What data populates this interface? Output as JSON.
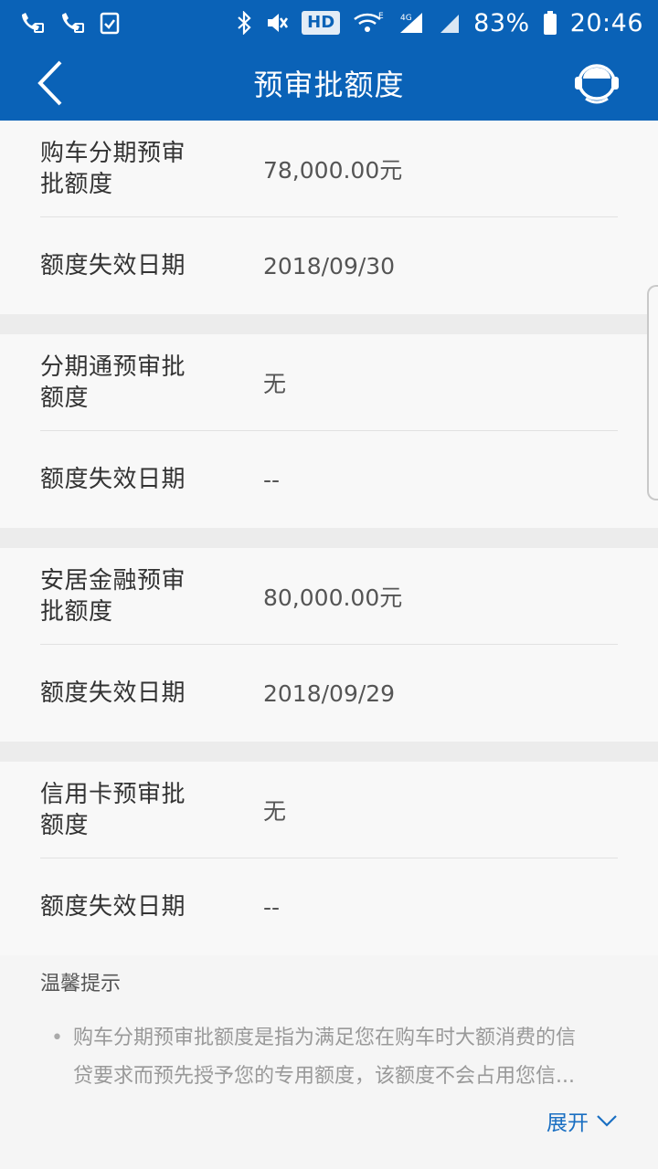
{
  "status_bar": {
    "hd": "HD",
    "network_e": "E",
    "network_4g": "4G",
    "battery": "83%",
    "time": "20:46"
  },
  "nav": {
    "title": "预审批额度",
    "back_icon": "chevron-left-icon",
    "service_icon": "customer-service-icon"
  },
  "sections": [
    {
      "quota_label": "购车分期预审批额度",
      "quota_label_line1": "购车分期预审",
      "quota_label_line2": "批额度",
      "quota_value": "78,000.00元",
      "expiry_label": "额度失效日期",
      "expiry_value": "2018/09/30"
    },
    {
      "quota_label_line1": "分期通预审批",
      "quota_label_line2": "额度",
      "quota_value": "无",
      "expiry_label": "额度失效日期",
      "expiry_value": "--"
    },
    {
      "quota_label_line1": "安居金融预审",
      "quota_label_line2": "批额度",
      "quota_value": "80,000.00元",
      "expiry_label": "额度失效日期",
      "expiry_value": "2018/09/29"
    },
    {
      "quota_label_line1": "信用卡预审批",
      "quota_label_line2": "额度",
      "quota_value": "无",
      "expiry_label": "额度失效日期",
      "expiry_value": "--"
    }
  ],
  "tips": {
    "title": "温馨提示",
    "bullet": "•",
    "text_line1": "购车分期预审批额度是指为满足您在购车时大额消费的信",
    "text_line2": "贷要求而预先授予您的专用额度，该额度不会占用您信..."
  },
  "expand_label": "展开",
  "colors": {
    "primary": "#0a62b7",
    "link": "#1a6fc2"
  }
}
